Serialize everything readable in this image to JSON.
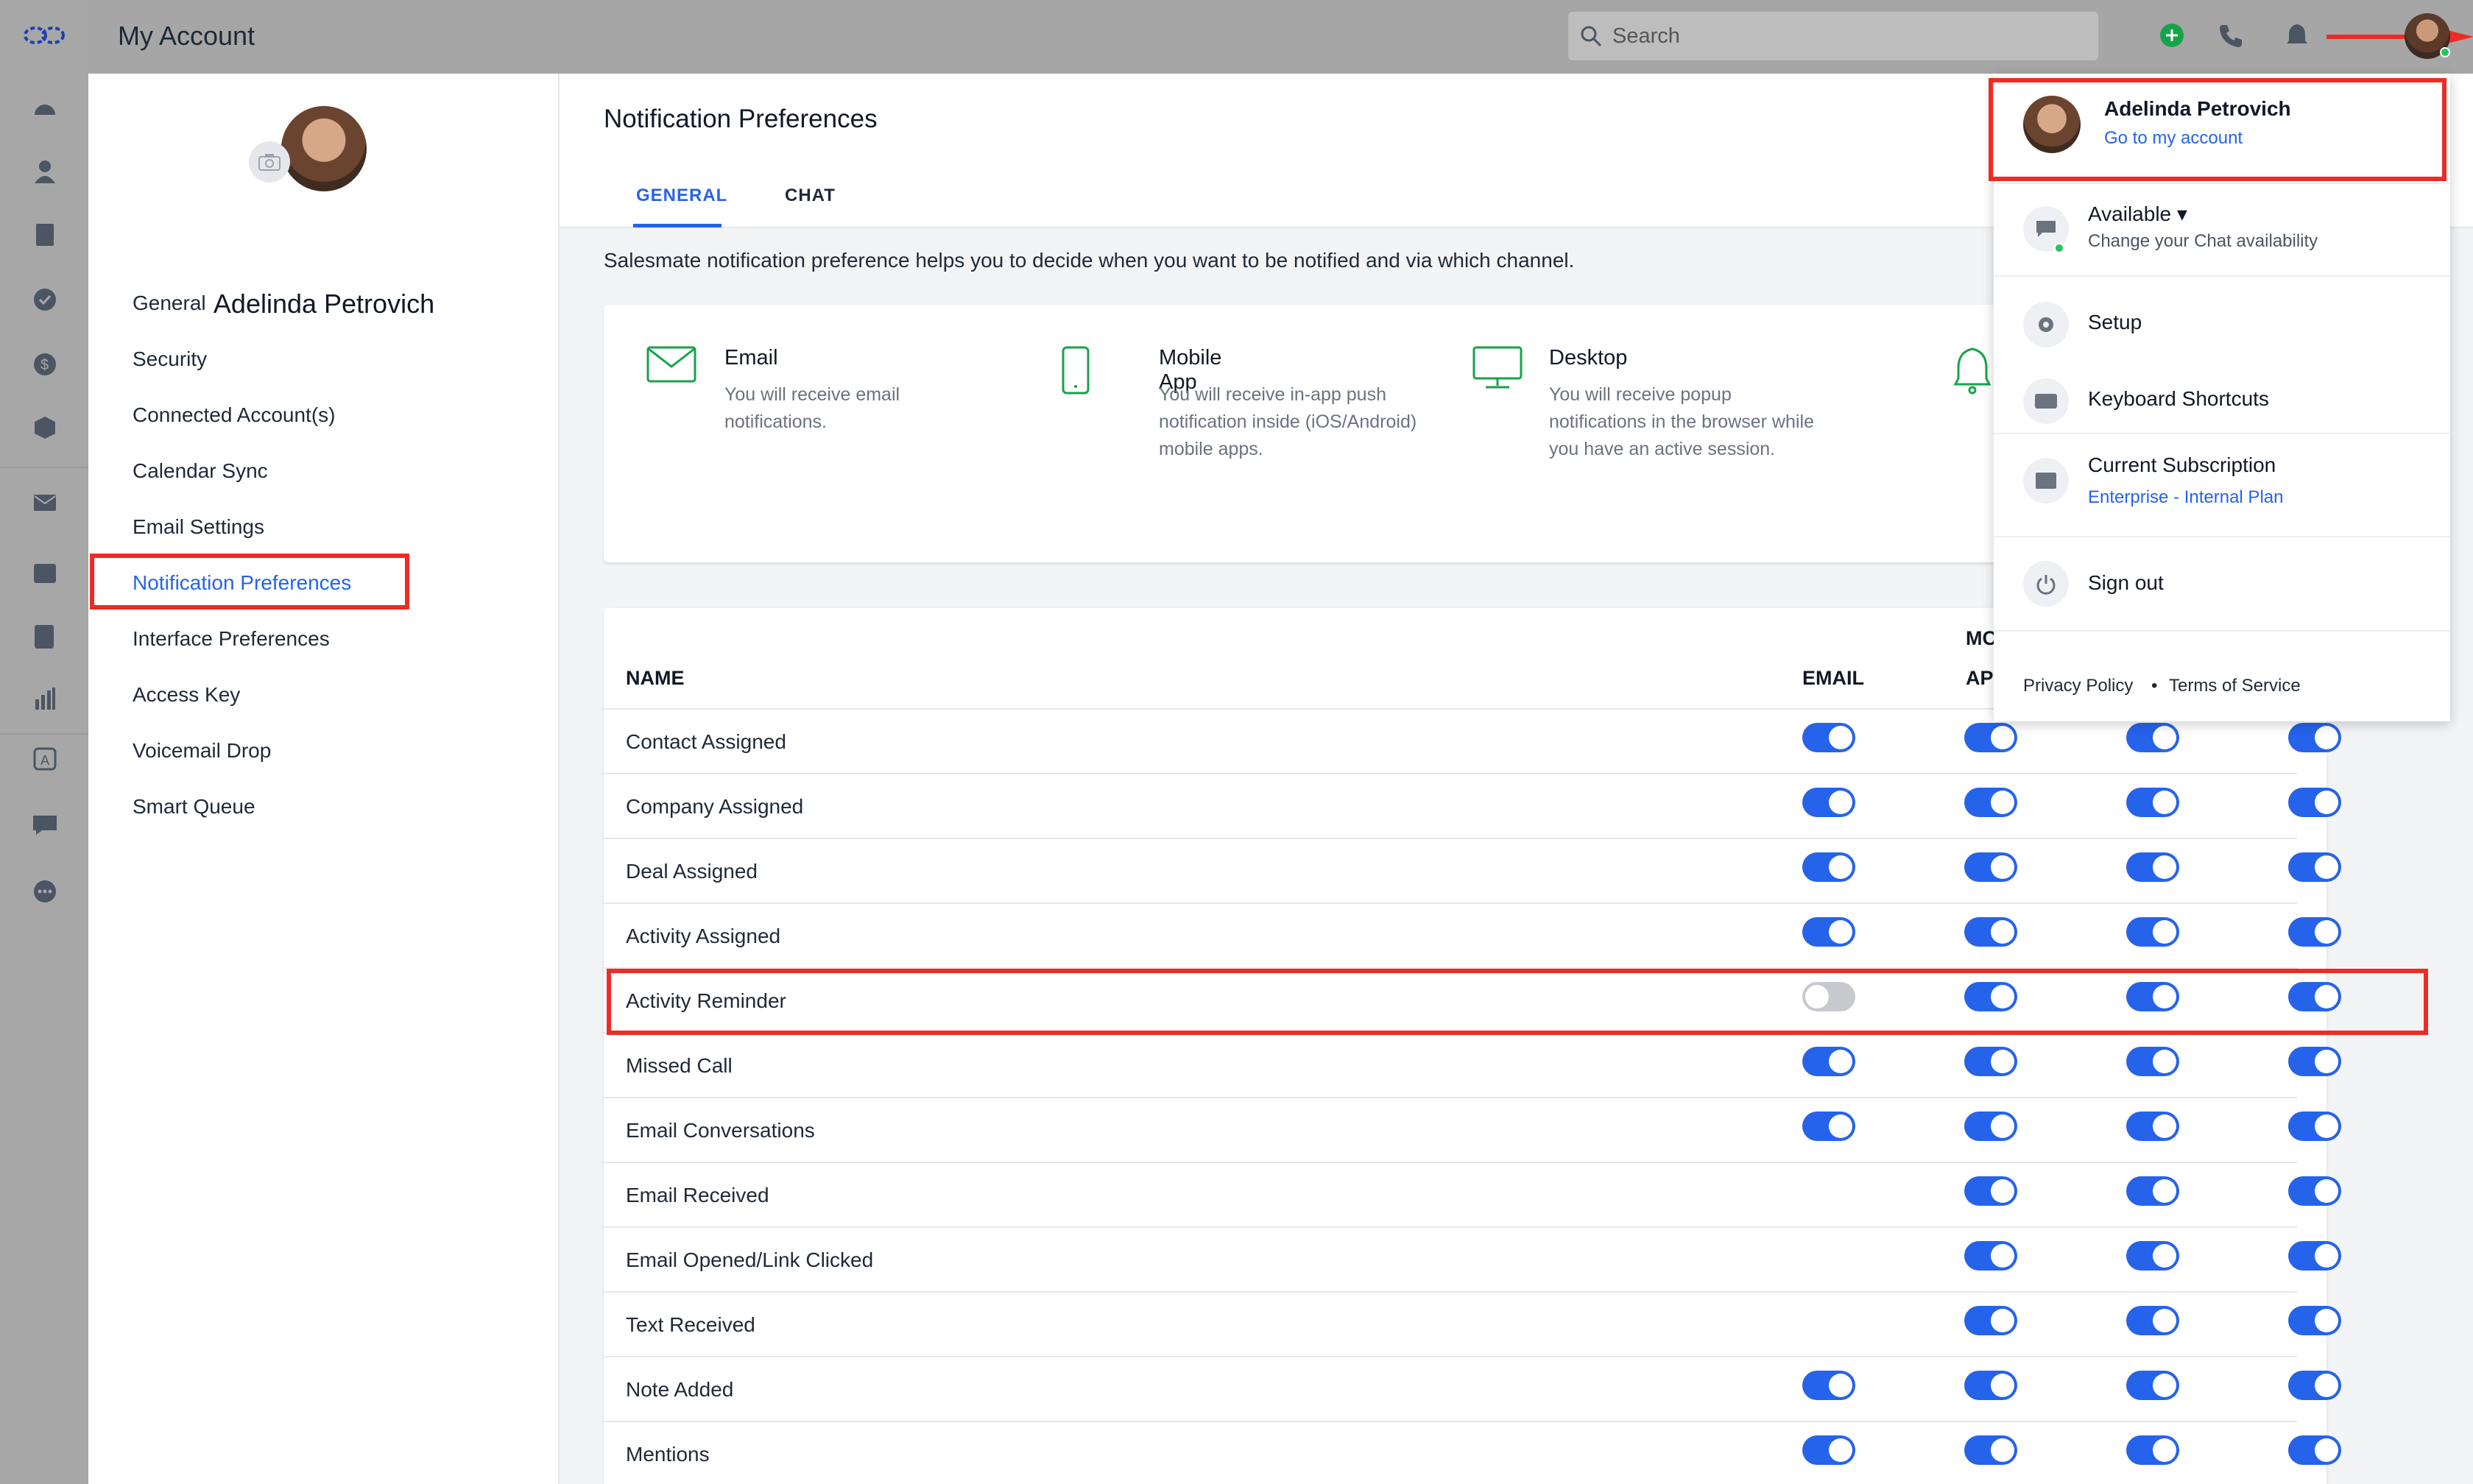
{
  "app": {
    "title": "My Account"
  },
  "search": {
    "placeholder": "Search"
  },
  "account": {
    "name": "Adelinda Petrovich",
    "menu": [
      "General",
      "Security",
      "Connected Account(s)",
      "Calendar Sync",
      "Email Settings",
      "Notification Preferences",
      "Interface Preferences",
      "Access Key",
      "Voicemail Drop",
      "Smart Queue"
    ],
    "active_item": "Notification Preferences"
  },
  "main": {
    "heading": "Notification Preferences",
    "tabs": [
      "GENERAL",
      "CHAT"
    ],
    "intro": "Salesmate notification preference helps you to decide when you want to be notified and via which channel.",
    "channels": [
      {
        "icon": "envelope-icon",
        "title": "Email",
        "desc": "You will receive email notifications."
      },
      {
        "icon": "mobile-icon",
        "title": "Mobile App",
        "desc": "You will receive in-app push notification inside (iOS/Android) mobile apps."
      },
      {
        "icon": "desktop-icon",
        "title": "Desktop",
        "desc": "You will receive popup notifications in the browser while you have an active session."
      }
    ]
  },
  "table": {
    "headers": {
      "name": "NAME",
      "email": "EMAIL",
      "mobile_top": "MC",
      "mobile_bottom": "AP"
    },
    "rows": [
      {
        "name": "Contact Assigned",
        "toggles": [
          true,
          true,
          true,
          true
        ]
      },
      {
        "name": "Company Assigned",
        "toggles": [
          true,
          true,
          true,
          true
        ]
      },
      {
        "name": "Deal Assigned",
        "toggles": [
          true,
          true,
          true,
          true
        ]
      },
      {
        "name": "Activity Assigned",
        "toggles": [
          true,
          true,
          true,
          true
        ]
      },
      {
        "name": "Activity Reminder",
        "toggles": [
          false,
          true,
          true,
          true
        ]
      },
      {
        "name": "Missed Call",
        "toggles": [
          true,
          true,
          true,
          true
        ]
      },
      {
        "name": "Email Conversations",
        "toggles": [
          true,
          true,
          true,
          true
        ]
      },
      {
        "name": "Email Received",
        "toggles": [
          null,
          true,
          true,
          true
        ]
      },
      {
        "name": "Email Opened/Link Clicked",
        "toggles": [
          null,
          true,
          true,
          true
        ]
      },
      {
        "name": "Text Received",
        "toggles": [
          null,
          true,
          true,
          true
        ]
      },
      {
        "name": "Note Added",
        "toggles": [
          true,
          true,
          true,
          true
        ]
      },
      {
        "name": "Mentions",
        "toggles": [
          true,
          true,
          true,
          true
        ]
      }
    ]
  },
  "dropdown": {
    "user_name": "Adelinda Petrovich",
    "go_account": "Go to my account",
    "availability": "Available",
    "availability_sub": "Change your Chat availability",
    "setup": "Setup",
    "shortcuts": "Keyboard Shortcuts",
    "subscription": "Current Subscription",
    "plan": "Enterprise - Internal Plan",
    "signout": "Sign out",
    "privacy": "Privacy Policy",
    "terms": "Terms of Service"
  },
  "colors": {
    "accent": "#2563eb",
    "highlight": "#ef2b25",
    "status": "#22c55e"
  }
}
